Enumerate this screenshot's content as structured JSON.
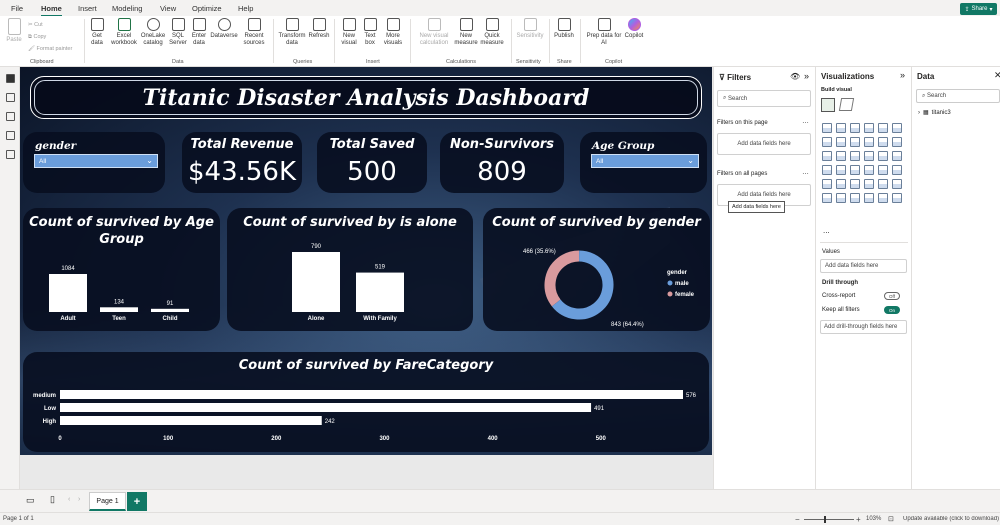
{
  "menu": [
    "File",
    "Home",
    "Insert",
    "Modeling",
    "View",
    "Optimize",
    "Help"
  ],
  "share_label": "Share",
  "ribbon": {
    "clipboard": {
      "paste": "Paste",
      "cut": "Cut",
      "copy": "Copy",
      "format_painter": "Format painter",
      "group": "Clipboard"
    },
    "data_buttons": [
      "Get data",
      "Excel workbook",
      "OneLake catalog",
      "SQL Server",
      "Enter data",
      "Dataverse",
      "Recent sources"
    ],
    "data_group": "Data",
    "queries_buttons": [
      "Transform data",
      "Refresh"
    ],
    "queries_group": "Queries",
    "insert_buttons": [
      "New visual",
      "Text box",
      "More visuals"
    ],
    "insert_group": "Insert",
    "calc_buttons": [
      "New visual calculation",
      "New measure",
      "Quick measure"
    ],
    "calc_group": "Calculations",
    "sensitivity_button": "Sensitivity",
    "sensitivity_group": "Sensitivity",
    "share_button": "Publish",
    "share_group": "Share",
    "copilot_buttons": [
      "Prep data for AI",
      "Copilot"
    ],
    "copilot_group": "Copilot"
  },
  "dashboard": {
    "title": "Titanic Disaster Analysis Dashboard",
    "slicer_gender": {
      "label": "gender",
      "value": "All"
    },
    "slicer_age": {
      "label": "Age Group",
      "value": "All"
    },
    "kpis": [
      {
        "label": "Total Revenue",
        "value": "$43.56K"
      },
      {
        "label": "Total Saved",
        "value": "500"
      },
      {
        "label": "Non-Survivors",
        "value": "809"
      }
    ]
  },
  "charts": {
    "age": {
      "title": "Count of survived by Age Group"
    },
    "alone": {
      "title": "Count of survived by is alone"
    },
    "gender": {
      "title": "Count of survived by gender",
      "legend_title": "gender"
    },
    "fare": {
      "title": "Count of survived by FareCategory"
    }
  },
  "chart_data": [
    {
      "type": "bar",
      "title": "Count of survived by Age Group",
      "categories": [
        "Adult",
        "Teen",
        "Child"
      ],
      "values": [
        1084,
        134,
        91
      ]
    },
    {
      "type": "bar",
      "title": "Count of survived by is alone",
      "categories": [
        "Alone",
        "With Family"
      ],
      "values": [
        790,
        519
      ]
    },
    {
      "type": "pie",
      "title": "Count of survived by gender",
      "categories": [
        "male",
        "female"
      ],
      "values": [
        843,
        466
      ],
      "data_labels": [
        "843 (64.4%)",
        "466 (35.6%)"
      ],
      "colors": [
        "#6a9ddb",
        "#d99a9e"
      ],
      "legend": "right"
    },
    {
      "type": "bar",
      "orientation": "horizontal",
      "title": "Count of survived by FareCategory",
      "categories": [
        "medium",
        "Low",
        "High"
      ],
      "values": [
        576,
        491,
        242
      ],
      "xticks": [
        0,
        100,
        200,
        300,
        400,
        500
      ],
      "xlim": [
        0,
        600
      ]
    }
  ],
  "filters": {
    "title": "Filters",
    "search_placeholder": "Search",
    "on_page": "Filters on this page",
    "on_all": "Filters on all pages",
    "add_fields": "Add data fields here",
    "tooltip": "Add data fields here"
  },
  "viz": {
    "title": "Visualizations",
    "build": "Build visual",
    "values": "Values",
    "add_fields": "Add data fields here",
    "drill": "Drill through",
    "cross": "Cross-report",
    "cross_state": "Off",
    "keep": "Keep all filters",
    "keep_state": "On",
    "drill_fields": "Add drill-through fields here",
    "more": "..."
  },
  "data_pane": {
    "title": "Data",
    "search_placeholder": "Search",
    "table": "titanic3"
  },
  "pages": {
    "tab": "Page 1",
    "add": "+"
  },
  "status": {
    "page": "Page 1 of 1",
    "zoom": "103%",
    "update": "Update available (click to download)"
  }
}
